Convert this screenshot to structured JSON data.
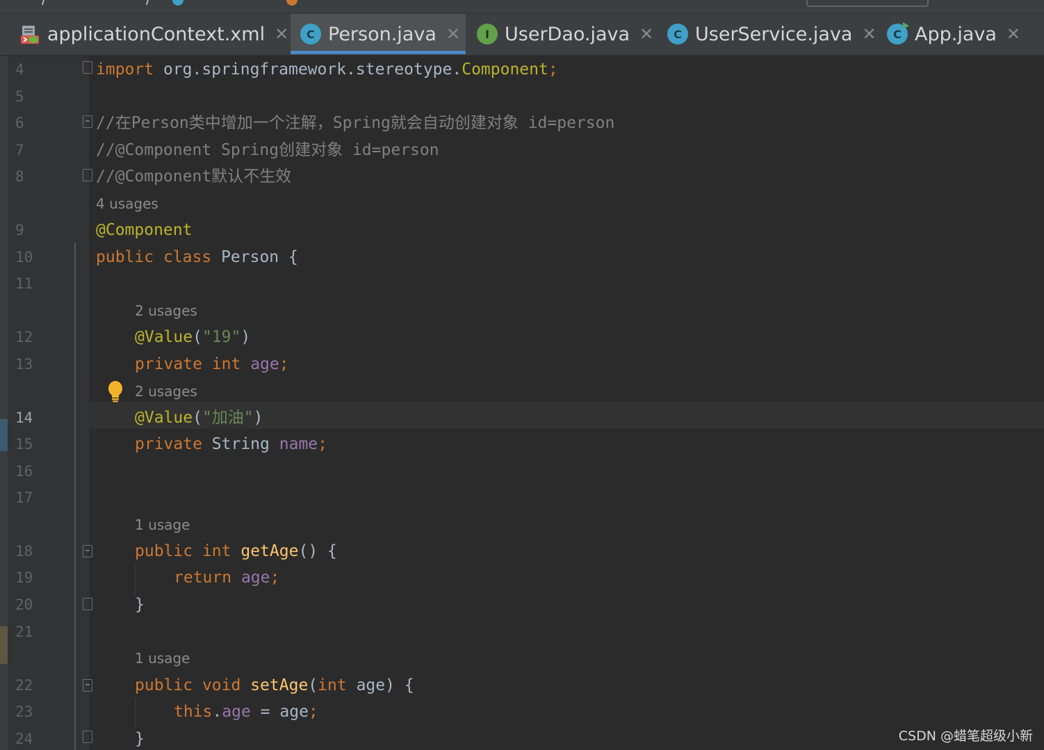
{
  "tabs": [
    {
      "label": "applicationContext.xml",
      "icon": "xml-file-icon",
      "active": false
    },
    {
      "label": "Person.java",
      "icon": "class-icon",
      "icon_letter": "C",
      "active": true
    },
    {
      "label": "UserDao.java",
      "icon": "interface-icon",
      "icon_letter": "I",
      "active": false
    },
    {
      "label": "UserService.java",
      "icon": "class-icon",
      "icon_letter": "C",
      "active": false
    },
    {
      "label": "App.java",
      "icon": "runnable-class-icon",
      "icon_letter": "C",
      "active": false
    }
  ],
  "close_glyph": "✕",
  "editor": {
    "current_line": 14,
    "lines": [
      {
        "num": "4",
        "code": "import org.springframework.stereotype.Component;"
      },
      {
        "num": "5",
        "code": ""
      },
      {
        "num": "6",
        "code": "//在Person类中增加一个注解，Spring就会自动创建对象 id=person"
      },
      {
        "num": "7",
        "code": "//@Component Spring创建对象 id=person"
      },
      {
        "num": "8",
        "code": "//@Component默认不生效"
      },
      {
        "hint": "4 usages"
      },
      {
        "num": "9",
        "code": "@Component"
      },
      {
        "num": "10",
        "code": "public class Person {"
      },
      {
        "num": "11",
        "code": ""
      },
      {
        "hint": "2 usages"
      },
      {
        "num": "12",
        "code": "@Value(\"19\")"
      },
      {
        "num": "13",
        "code": "private int age;"
      },
      {
        "hint": "2 usages"
      },
      {
        "num": "14",
        "code": "@Value(\"加油\")"
      },
      {
        "num": "15",
        "code": "private String name;"
      },
      {
        "num": "16",
        "code": ""
      },
      {
        "num": "17",
        "code": ""
      },
      {
        "hint": "1 usage"
      },
      {
        "num": "18",
        "code": "public int getAge() {"
      },
      {
        "num": "19",
        "code": "return age;"
      },
      {
        "num": "20",
        "code": "}"
      },
      {
        "num": "21",
        "code": ""
      },
      {
        "hint": "1 usage"
      },
      {
        "num": "22",
        "code": "public void setAge(int age) {"
      },
      {
        "num": "23",
        "code": "this.age = age;"
      },
      {
        "num": "24",
        "code": "}"
      }
    ]
  },
  "colors": {
    "keyword": "#cc7832",
    "comment": "#808080",
    "annotation": "#bbb529",
    "string": "#6a8759",
    "field": "#9876aa",
    "method": "#ffc66d",
    "text": "#a9b7c6",
    "background": "#2b2b2b",
    "active_tab_underline": "#4a88c7"
  },
  "watermark": "CSDN @蜡笔超级小新"
}
